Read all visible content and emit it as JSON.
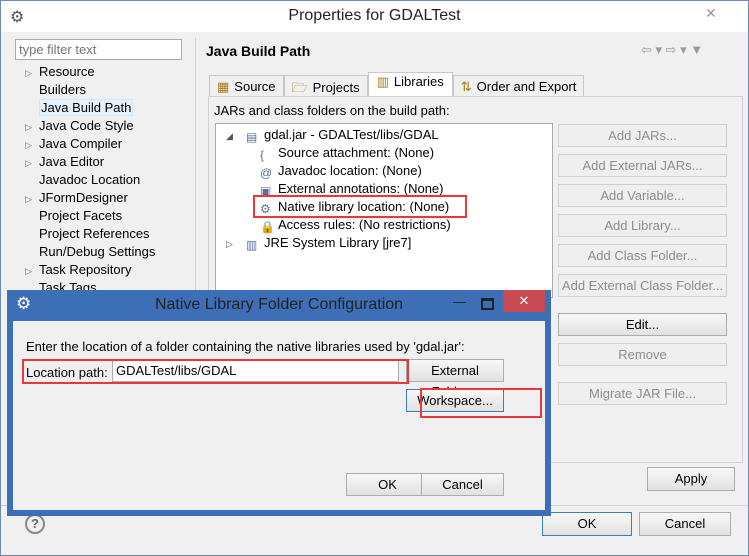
{
  "window": {
    "title": "Properties for GDALTest",
    "close": "✕"
  },
  "filter": {
    "placeholder": "type filter text"
  },
  "nav": [
    {
      "label": "Resource",
      "expand": true
    },
    {
      "label": "Builders",
      "expand": false
    },
    {
      "label": "Java Build Path",
      "expand": false,
      "selected": true
    },
    {
      "label": "Java Code Style",
      "expand": true
    },
    {
      "label": "Java Compiler",
      "expand": true
    },
    {
      "label": "Java Editor",
      "expand": true
    },
    {
      "label": "Javadoc Location",
      "expand": false
    },
    {
      "label": "JFormDesigner",
      "expand": true
    },
    {
      "label": "Project Facets",
      "expand": false
    },
    {
      "label": "Project References",
      "expand": false
    },
    {
      "label": "Run/Debug Settings",
      "expand": false
    },
    {
      "label": "Task Repository",
      "expand": true
    },
    {
      "label": "Task Tags",
      "expand": false
    }
  ],
  "page": {
    "title": "Java Build Path",
    "tabs": [
      "Source",
      "Projects",
      "Libraries",
      "Order and Export"
    ],
    "active_tab": "Libraries",
    "list_label": "JARs and class folders on the build path:"
  },
  "tree": [
    {
      "label": "gdal.jar - GDALTest/libs/GDAL",
      "level": 0,
      "icon": "jar-icon"
    },
    {
      "label": "Source attachment: (None)",
      "level": 1,
      "icon": "source-attachment-icon"
    },
    {
      "label": "Javadoc location: (None)",
      "level": 1,
      "icon": "javadoc-icon"
    },
    {
      "label": "External annotations: (None)",
      "level": 1,
      "icon": "annotations-icon"
    },
    {
      "label": "Native library location: (None)",
      "level": 1,
      "icon": "native-library-icon",
      "highlighted": true
    },
    {
      "label": "Access rules: (No restrictions)",
      "level": 1,
      "icon": "access-rules-icon"
    },
    {
      "label": "JRE System Library [jre7]",
      "level": 0,
      "icon": "library-icon"
    }
  ],
  "side_buttons": [
    {
      "label": "Add JARs...",
      "enabled": false
    },
    {
      "label": "Add External JARs...",
      "enabled": false
    },
    {
      "label": "Add Variable...",
      "enabled": false
    },
    {
      "label": "Add Library...",
      "enabled": false
    },
    {
      "label": "Add Class Folder...",
      "enabled": false
    },
    {
      "label": "Add External Class Folder...",
      "enabled": false
    },
    {
      "label": "Edit...",
      "enabled": true
    },
    {
      "label": "Remove",
      "enabled": false
    },
    {
      "label": "Migrate JAR File...",
      "enabled": false
    }
  ],
  "apply": "Apply",
  "ok": "OK",
  "cancel": "Cancel",
  "help": "?",
  "dialog": {
    "title": "Native Library Folder Configuration",
    "message": "Enter the location of a folder containing the native libraries used by 'gdal.jar':",
    "location_label": "Location path:",
    "location_value": "GDALTest/libs/GDAL",
    "external_folder": "External Folder...",
    "workspace": "Workspace...",
    "ok": "OK",
    "cancel": "Cancel",
    "close": "✕"
  },
  "colors": {
    "dialog_border": "#3d6fb6",
    "close_red": "#c74b50",
    "highlight": "#e8383b"
  }
}
